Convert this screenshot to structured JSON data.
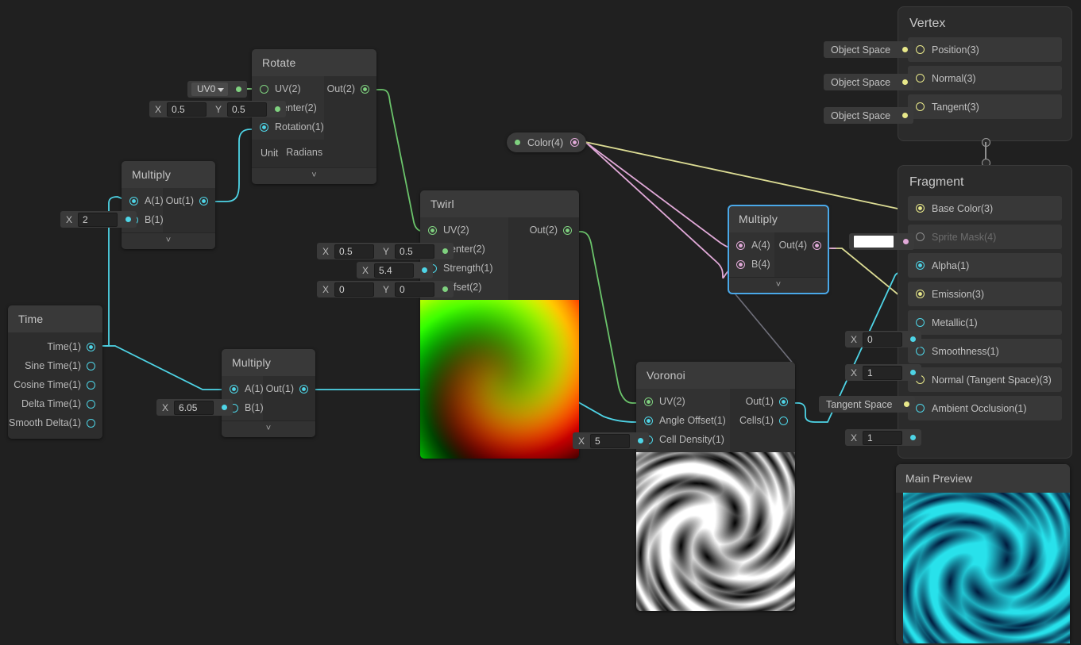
{
  "canvas": {
    "background": "#202020"
  },
  "colors": {
    "vector2": "#7fd17f",
    "float": "#4ed4e6",
    "vector4": "#e1a9d8",
    "vector3": "#e8e88a",
    "selection": "#4aa8e8"
  },
  "nodes": {
    "time": {
      "title": "Time",
      "outputs": [
        {
          "label": "Time(1)",
          "type": "float",
          "connected": true
        },
        {
          "label": "Sine Time(1)",
          "type": "float",
          "connected": false
        },
        {
          "label": "Cosine Time(1)",
          "type": "float",
          "connected": false
        },
        {
          "label": "Delta Time(1)",
          "type": "float",
          "connected": false
        },
        {
          "label": "Smooth Delta(1)",
          "type": "float",
          "connected": false
        }
      ]
    },
    "multiply_a": {
      "title": "Multiply",
      "inputs": [
        {
          "label": "A(1)",
          "type": "float",
          "connected": true
        },
        {
          "label": "B(1)",
          "type": "float",
          "connected": false,
          "slot": {
            "axis": "X",
            "value": "2"
          }
        }
      ],
      "outputs": [
        {
          "label": "Out(1)",
          "type": "float",
          "connected": true
        }
      ]
    },
    "multiply_b": {
      "title": "Multiply",
      "inputs": [
        {
          "label": "A(1)",
          "type": "float",
          "connected": true
        },
        {
          "label": "B(1)",
          "type": "float",
          "connected": false,
          "slot": {
            "axis": "X",
            "value": "6.05"
          }
        }
      ],
      "outputs": [
        {
          "label": "Out(1)",
          "type": "float",
          "connected": true
        }
      ]
    },
    "rotate": {
      "title": "Rotate",
      "inputs": [
        {
          "label": "UV(2)",
          "type": "vector2",
          "connected": false,
          "slot": {
            "enum": "UV0"
          }
        },
        {
          "label": "Center(2)",
          "type": "vector2",
          "connected": false,
          "slot": {
            "axis": "X",
            "value": "0.5",
            "axis2": "Y",
            "value2": "0.5"
          }
        },
        {
          "label": "Rotation(1)",
          "type": "float",
          "connected": true
        }
      ],
      "outputs": [
        {
          "label": "Out(2)",
          "type": "vector2",
          "connected": true
        }
      ],
      "control": {
        "label": "Unit",
        "value": "Radians"
      }
    },
    "twirl": {
      "title": "Twirl",
      "inputs": [
        {
          "label": "UV(2)",
          "type": "vector2",
          "connected": true
        },
        {
          "label": "Center(2)",
          "type": "vector2",
          "connected": false,
          "slot": {
            "axis": "X",
            "value": "0.5",
            "axis2": "Y",
            "value2": "0.5"
          }
        },
        {
          "label": "Strength(1)",
          "type": "float",
          "connected": false,
          "slot": {
            "axis": "X",
            "value": "5.4"
          }
        },
        {
          "label": "Offset(2)",
          "type": "vector2",
          "connected": false,
          "slot": {
            "axis": "X",
            "value": "0",
            "axis2": "Y",
            "value2": "0"
          }
        }
      ],
      "outputs": [
        {
          "label": "Out(2)",
          "type": "vector2",
          "connected": true
        }
      ],
      "preview": "twirl-gradient"
    },
    "voronoi": {
      "title": "Voronoi",
      "inputs": [
        {
          "label": "UV(2)",
          "type": "vector2",
          "connected": true
        },
        {
          "label": "Angle Offset(1)",
          "type": "float",
          "connected": true
        },
        {
          "label": "Cell Density(1)",
          "type": "float",
          "connected": false,
          "slot": {
            "axis": "X",
            "value": "5"
          }
        }
      ],
      "outputs": [
        {
          "label": "Out(1)",
          "type": "float",
          "connected": true
        },
        {
          "label": "Cells(1)",
          "type": "float",
          "connected": false
        }
      ],
      "preview": "voronoi-swirl"
    },
    "multiply_c": {
      "title": "Multiply",
      "selected": true,
      "inputs": [
        {
          "label": "A(4)",
          "type": "vector4",
          "connected": true
        },
        {
          "label": "B(4)",
          "type": "vector4",
          "connected": true
        }
      ],
      "outputs": [
        {
          "label": "Out(4)",
          "type": "vector4",
          "connected": true
        }
      ]
    },
    "color": {
      "title": "Color(4)",
      "type": "vector4",
      "connected": true
    }
  },
  "master": {
    "vertex": {
      "title": "Vertex",
      "rows": [
        {
          "label": "Position(3)",
          "type": "vector3",
          "connected": false,
          "slot": "Object Space"
        },
        {
          "label": "Normal(3)",
          "type": "vector3",
          "connected": false,
          "slot": "Object Space"
        },
        {
          "label": "Tangent(3)",
          "type": "vector3",
          "connected": false,
          "slot": "Object Space"
        }
      ]
    },
    "fragment": {
      "title": "Fragment",
      "rows": [
        {
          "label": "Base Color(3)",
          "type": "vector3",
          "connected": true
        },
        {
          "label": "Sprite Mask(4)",
          "type": "vector4",
          "connected": false,
          "disabled": true,
          "slot": "color-swatch",
          "swatch": "#ffffff"
        },
        {
          "label": "Alpha(1)",
          "type": "float",
          "connected": true
        },
        {
          "label": "Emission(3)",
          "type": "vector3",
          "connected": true
        },
        {
          "label": "Metallic(1)",
          "type": "float",
          "connected": false,
          "slot": {
            "axis": "X",
            "value": "0"
          }
        },
        {
          "label": "Smoothness(1)",
          "type": "float",
          "connected": false,
          "slot": {
            "axis": "X",
            "value": "1"
          }
        },
        {
          "label": "Normal (Tangent Space)(3)",
          "type": "vector3",
          "connected": false,
          "slot": "Tangent Space"
        },
        {
          "label": "Ambient Occlusion(1)",
          "type": "float",
          "connected": false,
          "slot": {
            "axis": "X",
            "value": "1"
          }
        }
      ]
    }
  },
  "main_preview": {
    "title": "Main Preview"
  }
}
